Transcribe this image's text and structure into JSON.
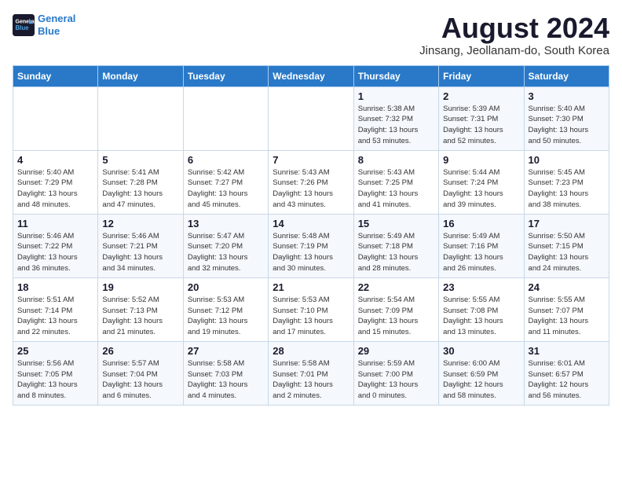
{
  "header": {
    "logo_line1": "General",
    "logo_line2": "Blue",
    "title": "August 2024",
    "subtitle": "Jinsang, Jeollanam-do, South Korea"
  },
  "days_of_week": [
    "Sunday",
    "Monday",
    "Tuesday",
    "Wednesday",
    "Thursday",
    "Friday",
    "Saturday"
  ],
  "weeks": [
    [
      {
        "day": "",
        "info": ""
      },
      {
        "day": "",
        "info": ""
      },
      {
        "day": "",
        "info": ""
      },
      {
        "day": "",
        "info": ""
      },
      {
        "day": "1",
        "info": "Sunrise: 5:38 AM\nSunset: 7:32 PM\nDaylight: 13 hours\nand 53 minutes."
      },
      {
        "day": "2",
        "info": "Sunrise: 5:39 AM\nSunset: 7:31 PM\nDaylight: 13 hours\nand 52 minutes."
      },
      {
        "day": "3",
        "info": "Sunrise: 5:40 AM\nSunset: 7:30 PM\nDaylight: 13 hours\nand 50 minutes."
      }
    ],
    [
      {
        "day": "4",
        "info": "Sunrise: 5:40 AM\nSunset: 7:29 PM\nDaylight: 13 hours\nand 48 minutes."
      },
      {
        "day": "5",
        "info": "Sunrise: 5:41 AM\nSunset: 7:28 PM\nDaylight: 13 hours\nand 47 minutes."
      },
      {
        "day": "6",
        "info": "Sunrise: 5:42 AM\nSunset: 7:27 PM\nDaylight: 13 hours\nand 45 minutes."
      },
      {
        "day": "7",
        "info": "Sunrise: 5:43 AM\nSunset: 7:26 PM\nDaylight: 13 hours\nand 43 minutes."
      },
      {
        "day": "8",
        "info": "Sunrise: 5:43 AM\nSunset: 7:25 PM\nDaylight: 13 hours\nand 41 minutes."
      },
      {
        "day": "9",
        "info": "Sunrise: 5:44 AM\nSunset: 7:24 PM\nDaylight: 13 hours\nand 39 minutes."
      },
      {
        "day": "10",
        "info": "Sunrise: 5:45 AM\nSunset: 7:23 PM\nDaylight: 13 hours\nand 38 minutes."
      }
    ],
    [
      {
        "day": "11",
        "info": "Sunrise: 5:46 AM\nSunset: 7:22 PM\nDaylight: 13 hours\nand 36 minutes."
      },
      {
        "day": "12",
        "info": "Sunrise: 5:46 AM\nSunset: 7:21 PM\nDaylight: 13 hours\nand 34 minutes."
      },
      {
        "day": "13",
        "info": "Sunrise: 5:47 AM\nSunset: 7:20 PM\nDaylight: 13 hours\nand 32 minutes."
      },
      {
        "day": "14",
        "info": "Sunrise: 5:48 AM\nSunset: 7:19 PM\nDaylight: 13 hours\nand 30 minutes."
      },
      {
        "day": "15",
        "info": "Sunrise: 5:49 AM\nSunset: 7:18 PM\nDaylight: 13 hours\nand 28 minutes."
      },
      {
        "day": "16",
        "info": "Sunrise: 5:49 AM\nSunset: 7:16 PM\nDaylight: 13 hours\nand 26 minutes."
      },
      {
        "day": "17",
        "info": "Sunrise: 5:50 AM\nSunset: 7:15 PM\nDaylight: 13 hours\nand 24 minutes."
      }
    ],
    [
      {
        "day": "18",
        "info": "Sunrise: 5:51 AM\nSunset: 7:14 PM\nDaylight: 13 hours\nand 22 minutes."
      },
      {
        "day": "19",
        "info": "Sunrise: 5:52 AM\nSunset: 7:13 PM\nDaylight: 13 hours\nand 21 minutes."
      },
      {
        "day": "20",
        "info": "Sunrise: 5:53 AM\nSunset: 7:12 PM\nDaylight: 13 hours\nand 19 minutes."
      },
      {
        "day": "21",
        "info": "Sunrise: 5:53 AM\nSunset: 7:10 PM\nDaylight: 13 hours\nand 17 minutes."
      },
      {
        "day": "22",
        "info": "Sunrise: 5:54 AM\nSunset: 7:09 PM\nDaylight: 13 hours\nand 15 minutes."
      },
      {
        "day": "23",
        "info": "Sunrise: 5:55 AM\nSunset: 7:08 PM\nDaylight: 13 hours\nand 13 minutes."
      },
      {
        "day": "24",
        "info": "Sunrise: 5:55 AM\nSunset: 7:07 PM\nDaylight: 13 hours\nand 11 minutes."
      }
    ],
    [
      {
        "day": "25",
        "info": "Sunrise: 5:56 AM\nSunset: 7:05 PM\nDaylight: 13 hours\nand 8 minutes."
      },
      {
        "day": "26",
        "info": "Sunrise: 5:57 AM\nSunset: 7:04 PM\nDaylight: 13 hours\nand 6 minutes."
      },
      {
        "day": "27",
        "info": "Sunrise: 5:58 AM\nSunset: 7:03 PM\nDaylight: 13 hours\nand 4 minutes."
      },
      {
        "day": "28",
        "info": "Sunrise: 5:58 AM\nSunset: 7:01 PM\nDaylight: 13 hours\nand 2 minutes."
      },
      {
        "day": "29",
        "info": "Sunrise: 5:59 AM\nSunset: 7:00 PM\nDaylight: 13 hours\nand 0 minutes."
      },
      {
        "day": "30",
        "info": "Sunrise: 6:00 AM\nSunset: 6:59 PM\nDaylight: 12 hours\nand 58 minutes."
      },
      {
        "day": "31",
        "info": "Sunrise: 6:01 AM\nSunset: 6:57 PM\nDaylight: 12 hours\nand 56 minutes."
      }
    ]
  ]
}
